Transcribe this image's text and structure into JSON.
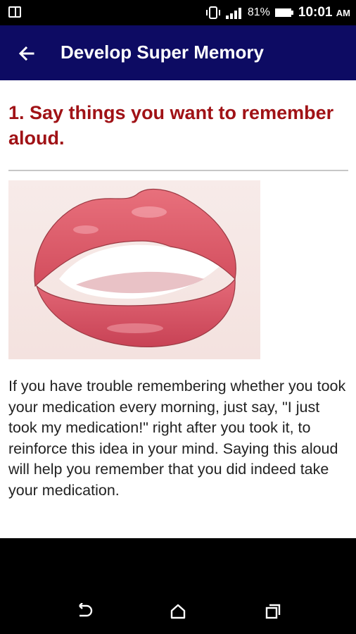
{
  "status_bar": {
    "battery": "81%",
    "time": "10:01",
    "ampm": "AM",
    "icons": [
      "notification-icon",
      "vibrate-icon",
      "signal-icon",
      "battery-icon"
    ]
  },
  "app_bar": {
    "title": "Develop Super Memory",
    "back_icon": "arrow-left-icon",
    "background_color": "#0d0b63"
  },
  "article": {
    "step_title": "1. Say things you want to remember aloud.",
    "title_color": "#a01216",
    "image": "lips-illustration",
    "body": "If you have trouble remembering whether you took your medication every morning, just say, \"I just took my medication!\" right after you took it, to reinforce this idea in your mind. Saying this aloud will help you remember that you did indeed take your medication."
  },
  "nav_bar": {
    "buttons": [
      "back-nav-icon",
      "home-nav-icon",
      "recents-nav-icon"
    ]
  }
}
